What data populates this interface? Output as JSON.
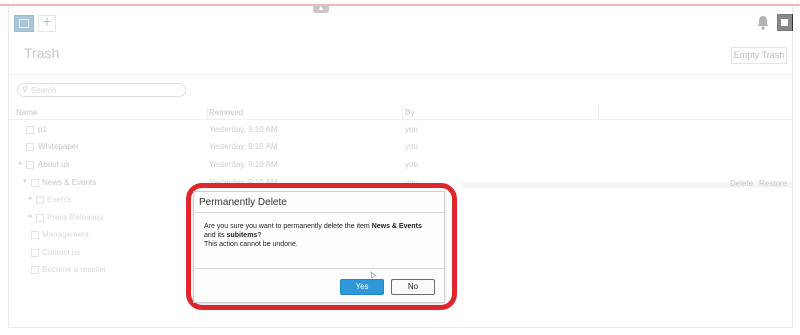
{
  "toolbar": {
    "tile_icon": "tile-icon",
    "add_label": "+",
    "collapse_label": "▲",
    "notification_icon": "bell-icon",
    "corner_icon": "square-icon"
  },
  "page": {
    "title": "Trash",
    "empty_trash_label": "Empty Trash"
  },
  "search": {
    "placeholder": "Search",
    "icon": "search-icon"
  },
  "grid": {
    "columns": [
      "Name",
      "Removed",
      "By"
    ],
    "rows": [
      {
        "name": "p1",
        "removed": "Yesterday, 9:10 AM",
        "by": "you",
        "toggle": ""
      },
      {
        "name": "Whitepaper",
        "removed": "Yesterday, 9:10 AM",
        "by": "you",
        "toggle": ""
      },
      {
        "name": "About us",
        "removed": "Yesterday, 9:10 AM",
        "by": "you",
        "toggle": "▸"
      },
      {
        "name": "News & Events",
        "removed": "Yesterday, 9:10 AM",
        "by": "you",
        "toggle": "▾"
      },
      {
        "name": "Events",
        "removed": "",
        "by": "",
        "toggle": "▸"
      },
      {
        "name": "Press Releases",
        "removed": "",
        "by": "",
        "toggle": "▸"
      },
      {
        "name": "Management",
        "removed": "",
        "by": "",
        "toggle": ""
      },
      {
        "name": "Contact us",
        "removed": "",
        "by": "",
        "toggle": ""
      },
      {
        "name": "Become a reseller",
        "removed": "",
        "by": "",
        "toggle": ""
      }
    ],
    "row_actions": {
      "delete_label": "Delete",
      "restore_label": "Restore"
    }
  },
  "dialog": {
    "title": "Permanently Delete",
    "message_prefix": "Are you sure you want to permanently delete the item ",
    "item_name": "News & Events",
    "message_middle": " and its ",
    "subitems_label": "subitems",
    "message_suffix": "?",
    "warning": "This action cannot be undone.",
    "yes_label": "Yes",
    "no_label": "No"
  },
  "colors": {
    "accent_button": "#2f98d9",
    "annotation": "#e0262d"
  }
}
